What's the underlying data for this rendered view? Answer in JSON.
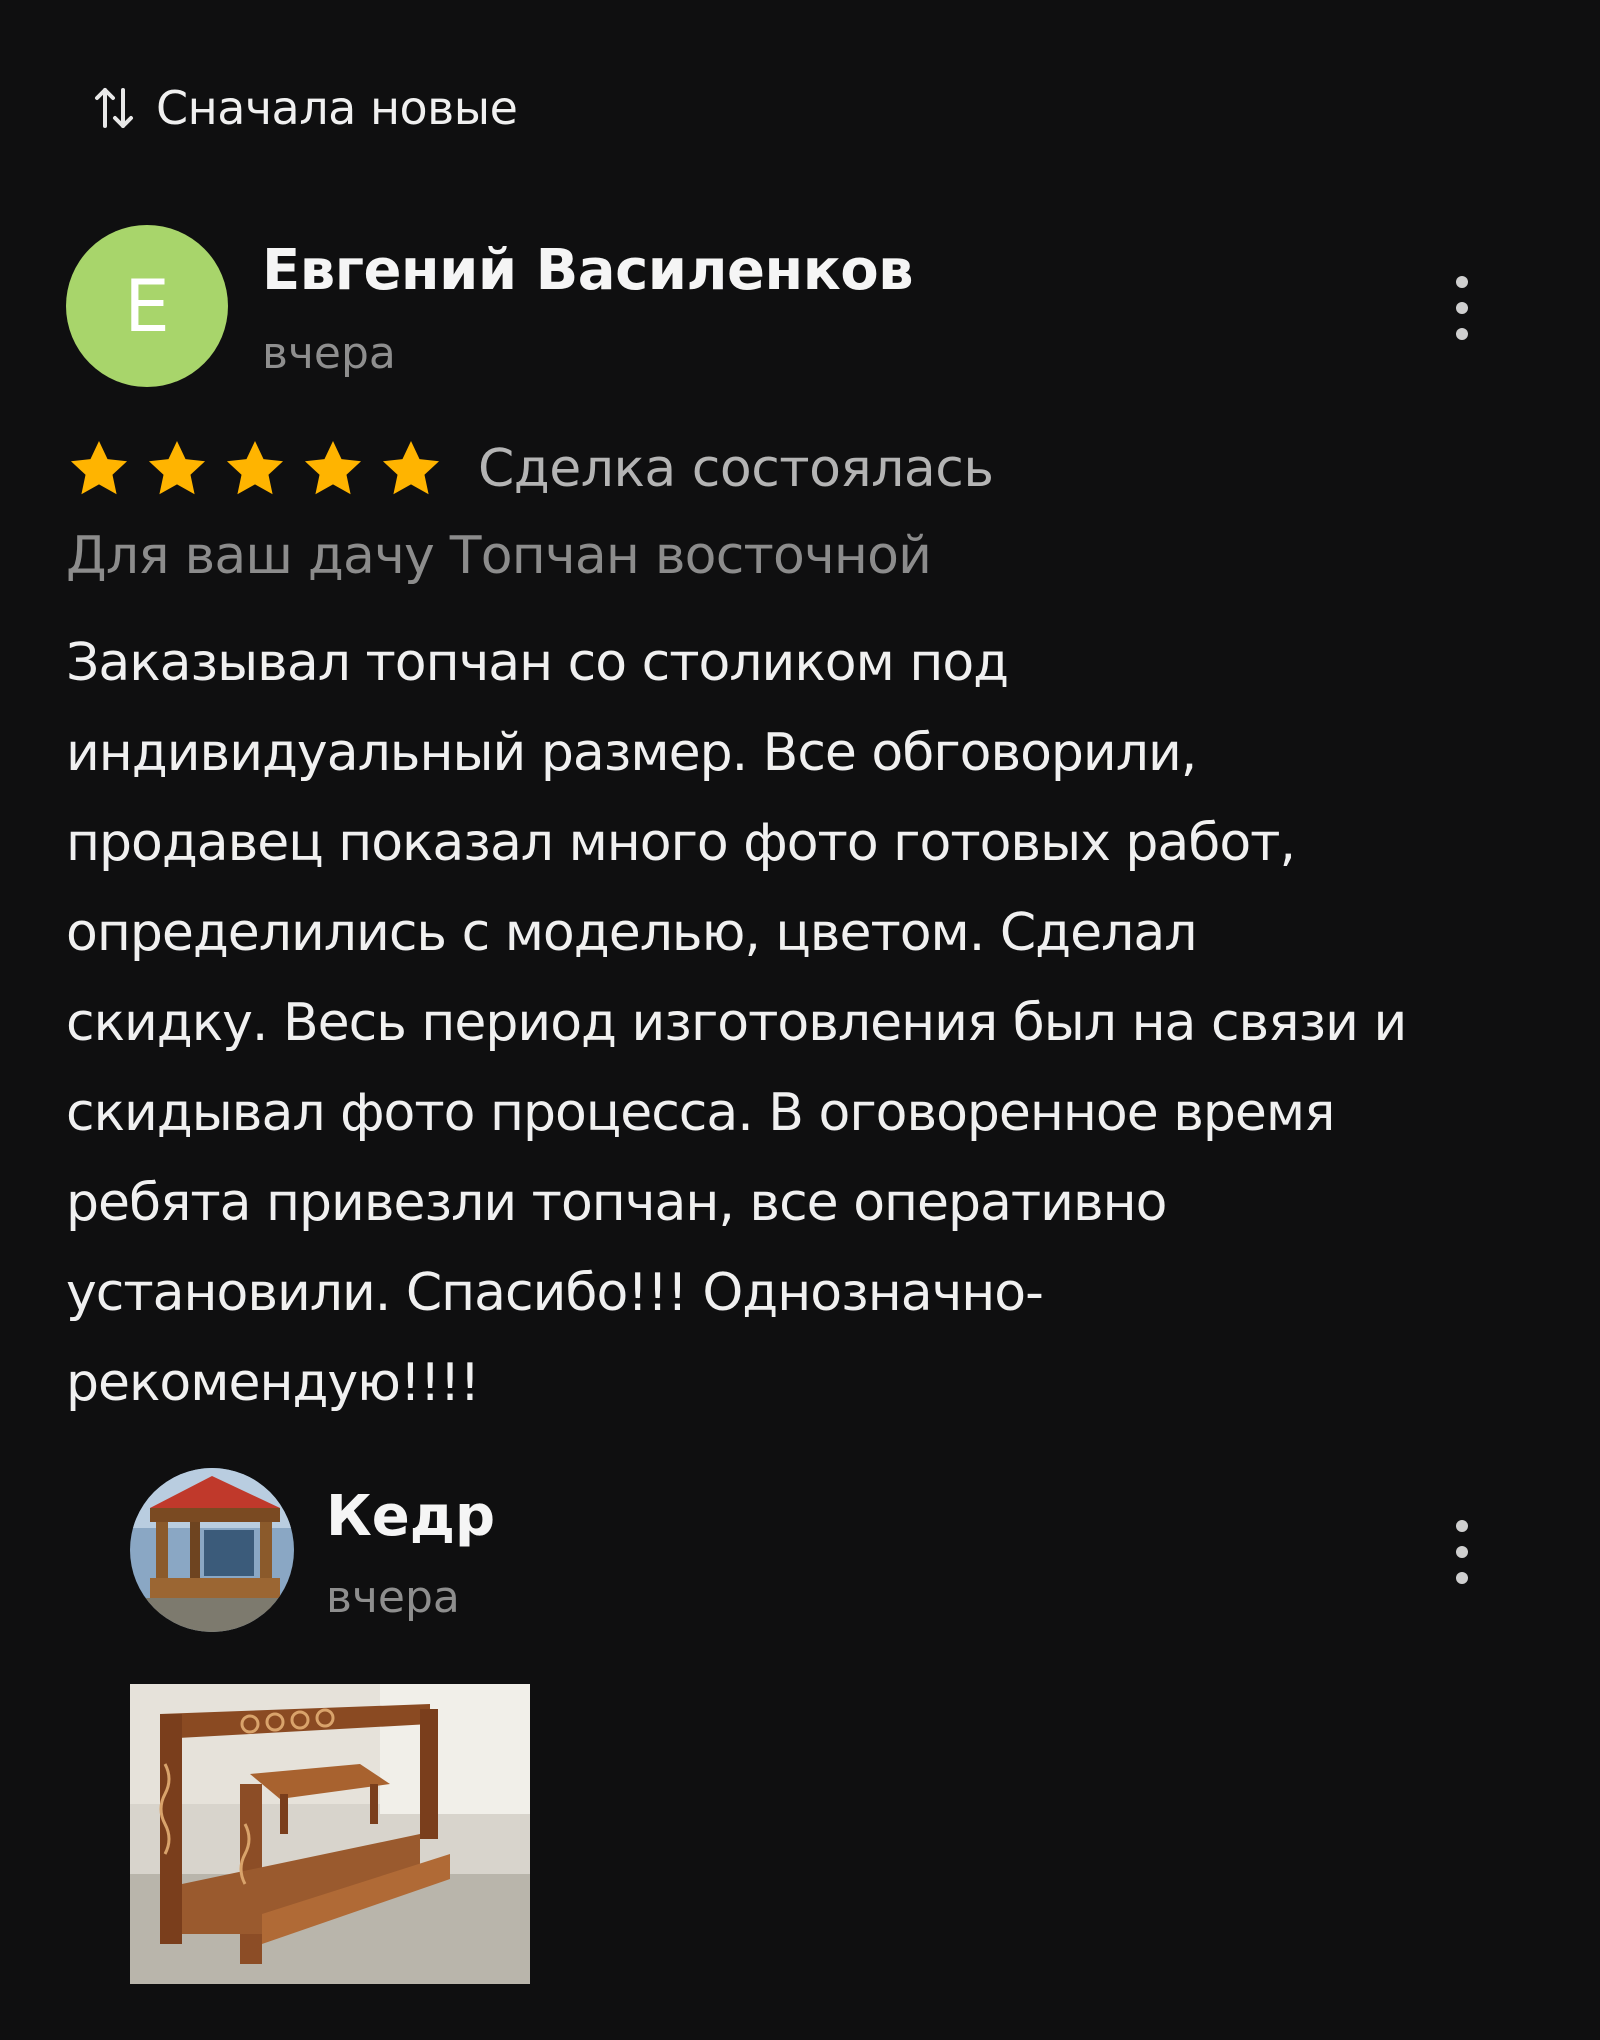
{
  "sort": {
    "icon": "sort-arrows-icon",
    "label": "Сначала новые"
  },
  "review": {
    "avatar_letter": "E",
    "avatar_color": "#a8d56b",
    "author": "Евгений Василенков",
    "date": "вчера",
    "rating": 5,
    "rating_max": 5,
    "star_color": "#ffb400",
    "deal_status": "Сделка состоялась",
    "item_title": "Для ваш дачу Топчан восточной",
    "text": "Заказывал топчан со столиком под\nиндивидуальный размер. Все обговорили,\nпродавец показал много фото готовых работ,\nопределились с моделью, цветом. Сделал\nскидку. Весь период изготовления был на связи и\nскидывал фото процесса. В оговоренное время\nребята привезли топчан, все оперативно\nустановили. Спасибо!!! Однозначно-\nрекомендую!!!!"
  },
  "reply": {
    "seller_name": "Кедр",
    "date": "вчера",
    "photo_count": 1
  }
}
